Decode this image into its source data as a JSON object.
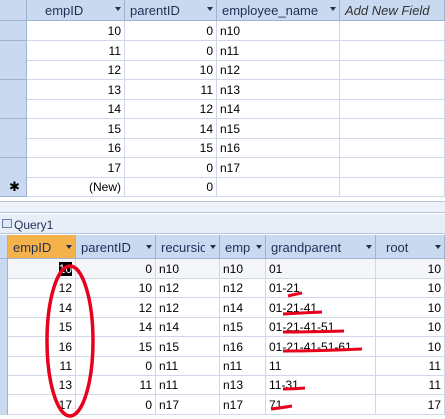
{
  "table": {
    "headers": [
      "empID",
      "parentID",
      "employee_name",
      "Add New Field"
    ],
    "rows": [
      [
        "10",
        "0",
        "n10"
      ],
      [
        "11",
        "0",
        "n11"
      ],
      [
        "12",
        "10",
        "n12"
      ],
      [
        "13",
        "11",
        "n13"
      ],
      [
        "14",
        "12",
        "n14"
      ],
      [
        "15",
        "14",
        "n15"
      ],
      [
        "16",
        "15",
        "n16"
      ],
      [
        "17",
        "0",
        "n17"
      ]
    ],
    "new_row": {
      "marker": "✱",
      "empID": "(New)",
      "parentID": "0"
    }
  },
  "query": {
    "tab_title": "Query1",
    "headers": [
      "empID",
      "parentID",
      "recursion",
      "emp",
      "grandparent",
      "root"
    ],
    "rows": [
      [
        "10",
        "0",
        "n10",
        "n10",
        "01",
        "10"
      ],
      [
        "12",
        "10",
        "n12",
        "n12",
        "01-21",
        "10"
      ],
      [
        "14",
        "12",
        "n12",
        "n14",
        "01-21-41",
        "10"
      ],
      [
        "15",
        "14",
        "n14",
        "n15",
        "01-21-41-51",
        "10"
      ],
      [
        "16",
        "15",
        "n15",
        "n16",
        "01-21-41-51-61",
        "10"
      ],
      [
        "11",
        "0",
        "n11",
        "n11",
        "11",
        "11"
      ],
      [
        "13",
        "11",
        "n11",
        "n13",
        "11-31",
        "11"
      ],
      [
        "17",
        "0",
        "n17",
        "n17",
        "71",
        "17"
      ]
    ]
  },
  "colors": {
    "header": "#c9d9f0",
    "active_header": "#f5b24a",
    "annotation": "#e8001c",
    "grid": "#cfd8e6"
  }
}
